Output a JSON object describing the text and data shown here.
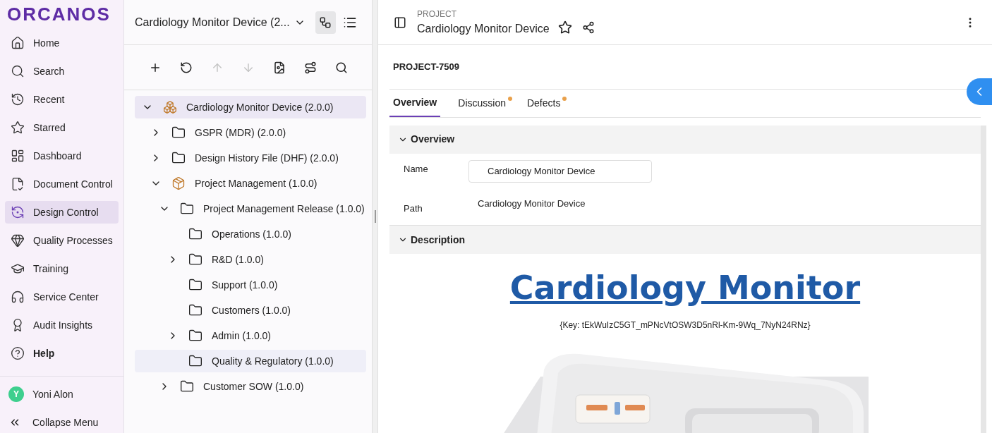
{
  "sidebar": {
    "logo": "ORCANOS",
    "items": [
      {
        "label": "Home",
        "selected": false
      },
      {
        "label": "Search",
        "selected": false
      },
      {
        "label": "Recent",
        "selected": false
      },
      {
        "label": "Starred",
        "selected": false
      },
      {
        "label": "Dashboard",
        "selected": false
      },
      {
        "label": "Document Control",
        "selected": false
      },
      {
        "label": "Design Control",
        "selected": true
      },
      {
        "label": "Quality Processes",
        "selected": false
      },
      {
        "label": "Training",
        "selected": false
      },
      {
        "label": "Service Center",
        "selected": false
      },
      {
        "label": "Audit Insights",
        "selected": false
      },
      {
        "label": "Help",
        "selected": false
      }
    ],
    "user": {
      "initial": "Y",
      "name": "Yoni Alon"
    },
    "collapse": "Collapse Menu"
  },
  "tree_panel": {
    "title": "Cardiology Monitor Device (2...",
    "view_tree_selected": true,
    "toolbar": [
      {
        "disabled": false
      },
      {
        "disabled": false
      },
      {
        "disabled": true
      },
      {
        "disabled": true
      },
      {
        "disabled": false
      },
      {
        "disabled": false
      },
      {
        "disabled": false
      }
    ],
    "items": [
      {
        "label": "Cardiology Monitor Device (2.0.0)",
        "kind": "product",
        "expanded": true,
        "selected": true,
        "hovered": false,
        "children": [
          {
            "label": "GSPR (MDR) (2.0.0)",
            "kind": "folder",
            "expanded": false,
            "selected": false,
            "hovered": false
          },
          {
            "label": "Design History File (DHF) (2.0.0)",
            "kind": "folder",
            "expanded": false,
            "selected": false,
            "hovered": false
          },
          {
            "label": "Project Management (1.0.0)",
            "kind": "package",
            "expanded": true,
            "selected": false,
            "hovered": false,
            "children": [
              {
                "label": "Project Management Release (1.0.0)",
                "kind": "folder",
                "expanded": true,
                "selected": false,
                "hovered": false,
                "children": [
                  {
                    "label": "Operations (1.0.0)",
                    "kind": "folder",
                    "selected": false,
                    "hovered": false
                  },
                  {
                    "label": "R&D (1.0.0)",
                    "kind": "folder",
                    "expanded": false,
                    "selected": false,
                    "hovered": false
                  },
                  {
                    "label": "Support (1.0.0)",
                    "kind": "folder",
                    "selected": false,
                    "hovered": false
                  },
                  {
                    "label": "Customers (1.0.0)",
                    "kind": "folder",
                    "selected": false,
                    "hovered": false
                  },
                  {
                    "label": "Admin (1.0.0)",
                    "kind": "folder",
                    "expanded": false,
                    "selected": false,
                    "hovered": false
                  },
                  {
                    "label": "Quality & Regulatory (1.0.0)",
                    "kind": "folder",
                    "selected": false,
                    "hovered": true
                  }
                ]
              },
              {
                "label": "Customer SOW (1.0.0)",
                "kind": "folder",
                "expanded": false,
                "selected": false,
                "hovered": false
              }
            ]
          }
        ]
      }
    ]
  },
  "main": {
    "type_label": "PROJECT",
    "title": "Cardiology Monitor Device",
    "id": "PROJECT-7509",
    "tabs": [
      {
        "label": "Overview",
        "selected": true,
        "dot": false
      },
      {
        "label": "Discussion",
        "selected": false,
        "dot": true
      },
      {
        "label": "Defects",
        "selected": false,
        "dot": true
      }
    ],
    "overview": {
      "heading": "Overview",
      "expanded": true,
      "name_label": "Name",
      "name_value": "Cardiology Monitor Device",
      "path_label": "Path",
      "path_value": "Cardiology Monitor Device"
    },
    "description": {
      "heading": "Description",
      "expanded": true,
      "title": "Cardiology Monitor",
      "key": "{Key: tEkWuIzC5GT_mPNcVtOSW3D5nRl-Km-9Wq_7NyN24RNz}"
    }
  }
}
